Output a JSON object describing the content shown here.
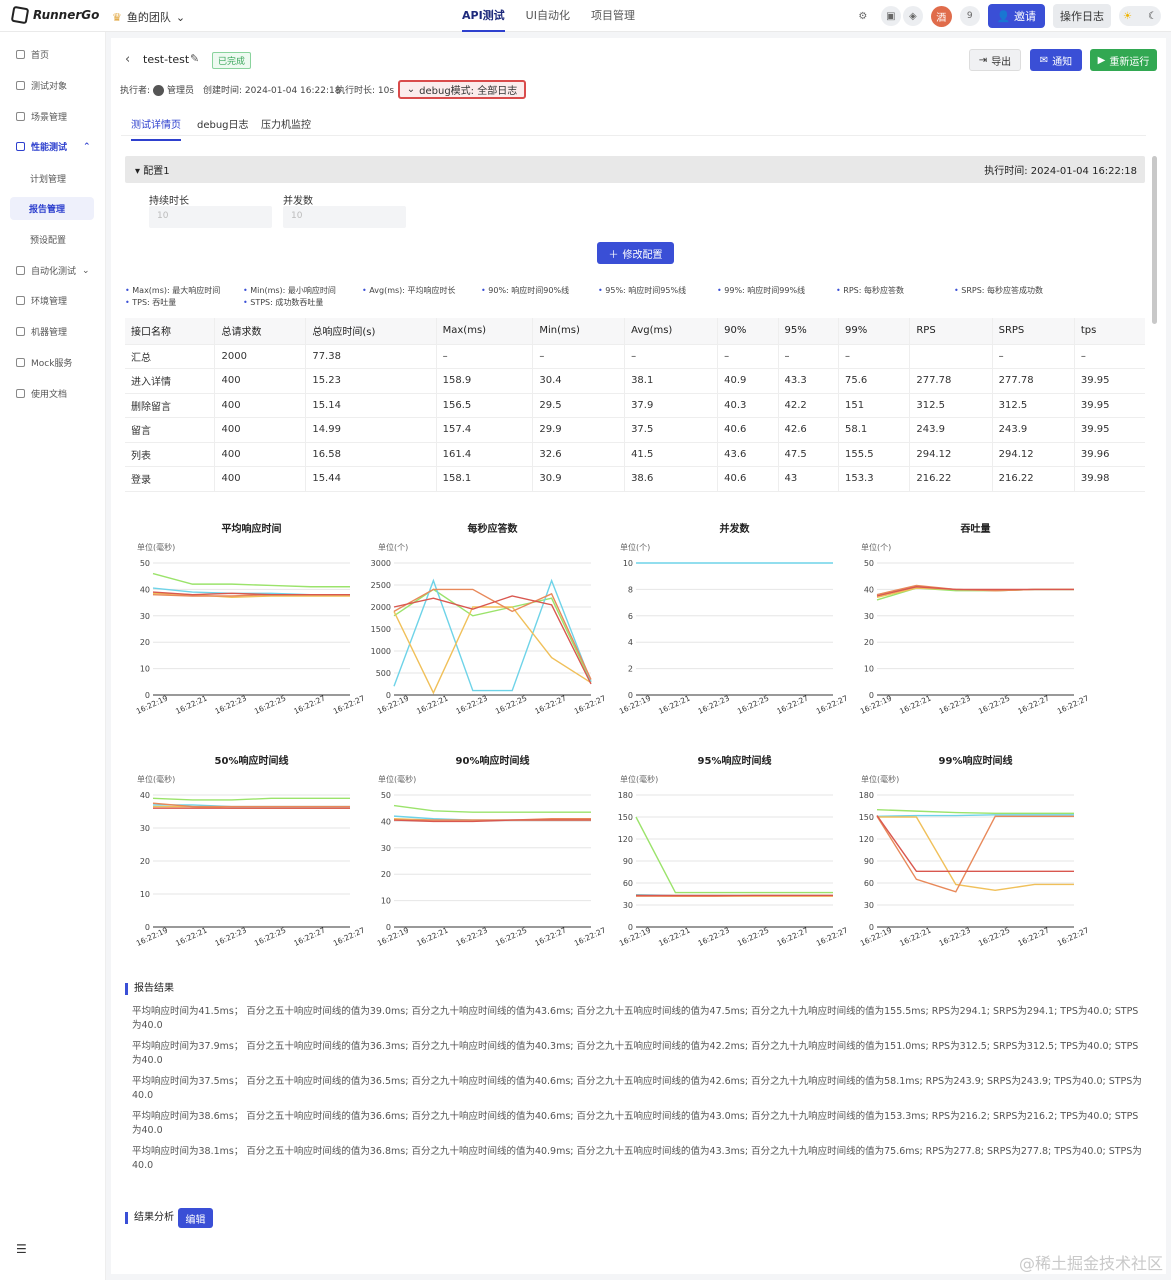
{
  "app": {
    "logo_text": "RunnerGo",
    "team": "鱼的团队"
  },
  "top_nav": {
    "tabs": [
      "API测试",
      "UI自动化",
      "项目管理"
    ],
    "active": 0
  },
  "top_right": {
    "member_count": "9",
    "invite": "邀请",
    "op_log": "操作日志"
  },
  "sidebar": {
    "items": [
      "首页",
      "测试对象",
      "场景管理",
      "性能测试",
      "计划管理",
      "报告管理",
      "预设配置",
      "自动化测试",
      "环境管理",
      "机器管理",
      "Mock服务",
      "使用文档"
    ]
  },
  "report": {
    "title": "test-test",
    "status": "已完成",
    "buttons": {
      "export": "导出",
      "notify": "通知",
      "rerun": "重新运行"
    },
    "meta": {
      "executor_label": "执行者:",
      "executor": "管理员",
      "created": "创建时间: 2024-01-04 16:22:18",
      "duration": "执行时长: 10s"
    },
    "debug_mode": "debug模式: 全部日志",
    "tabs": [
      "测试详情页",
      "debug日志",
      "压力机监控"
    ]
  },
  "config": {
    "name": "配置1",
    "exec_time": "执行时间: 2024-01-04 16:22:18",
    "duration_label": "持续时长",
    "duration_value": "10",
    "concurrency_label": "并发数",
    "concurrency_value": "10",
    "modify": "修改配置"
  },
  "legend_notes": [
    "Max(ms): 最大响应时间",
    "Min(ms): 最小响应时间",
    "Avg(ms): 平均响应时长",
    "90%: 响应时间90%线",
    "95%: 响应时间95%线",
    "99%: 响应时间99%线",
    "RPS: 每秒应答数",
    "SRPS: 每秒应答成功数",
    "TPS: 吞吐量",
    "STPS: 成功数吞吐量"
  ],
  "table": {
    "headers": [
      "接口名称",
      "总请求数",
      "总响应时间(s)",
      "Max(ms)",
      "Min(ms)",
      "Avg(ms)",
      "90%",
      "95%",
      "99%",
      "RPS",
      "SRPS",
      "tps"
    ],
    "rows": [
      [
        "汇总",
        "2000",
        "77.38",
        "–",
        "–",
        "–",
        "–",
        "–",
        "–",
        "",
        "–",
        "–"
      ],
      [
        "进入详情",
        "400",
        "15.23",
        "158.9",
        "30.4",
        "38.1",
        "40.9",
        "43.3",
        "75.6",
        "277.78",
        "277.78",
        "39.95"
      ],
      [
        "删除留言",
        "400",
        "15.14",
        "156.5",
        "29.5",
        "37.9",
        "40.3",
        "42.2",
        "151",
        "312.5",
        "312.5",
        "39.95"
      ],
      [
        "留言",
        "400",
        "14.99",
        "157.4",
        "29.9",
        "37.5",
        "40.6",
        "42.6",
        "58.1",
        "243.9",
        "243.9",
        "39.95"
      ],
      [
        "列表",
        "400",
        "16.58",
        "161.4",
        "32.6",
        "41.5",
        "43.6",
        "47.5",
        "155.5",
        "294.12",
        "294.12",
        "39.96"
      ],
      [
        "登录",
        "400",
        "15.44",
        "158.1",
        "30.9",
        "38.6",
        "40.6",
        "43",
        "153.3",
        "216.22",
        "216.22",
        "39.98"
      ]
    ]
  },
  "chart_data": [
    {
      "type": "line",
      "title": "平均响应时间",
      "ylabel": "单位(毫秒)",
      "ylim": [
        0,
        50
      ],
      "yticks": [
        0,
        10,
        20,
        30,
        40,
        50
      ],
      "x": [
        "16:22:19",
        "16:22:21",
        "16:22:23",
        "16:22:25",
        "16:22:27",
        "16:22:27"
      ],
      "series": [
        {
          "color": "#9be36b",
          "values": [
            46,
            42,
            42,
            41.5,
            41,
            41
          ]
        },
        {
          "color": "#6ed3e8",
          "values": [
            40.5,
            39,
            38.5,
            38.5,
            38,
            38
          ]
        },
        {
          "color": "#f0c05a",
          "values": [
            38.5,
            38,
            37,
            37.5,
            37.5,
            37.5
          ]
        },
        {
          "color": "#e8895a",
          "values": [
            38,
            37.5,
            37.5,
            38,
            38,
            38
          ]
        },
        {
          "color": "#d9574f",
          "values": [
            39,
            38,
            38.5,
            38,
            38,
            38
          ]
        }
      ]
    },
    {
      "type": "line",
      "title": "每秒应答数",
      "ylabel": "单位(个)",
      "ylim": [
        0,
        3000
      ],
      "yticks": [
        0,
        500,
        1000,
        1500,
        2000,
        2500,
        3000
      ],
      "x": [
        "16:22:19",
        "16:22:21",
        "16:22:23",
        "16:22:25",
        "16:22:27",
        "16:22:27"
      ],
      "series": [
        {
          "color": "#9be36b",
          "values": [
            1800,
            2400,
            1800,
            2000,
            2200,
            300
          ]
        },
        {
          "color": "#6ed3e8",
          "values": [
            200,
            2600,
            100,
            100,
            2600,
            300
          ]
        },
        {
          "color": "#f0c05a",
          "values": [
            1900,
            50,
            2000,
            2000,
            850,
            280
          ]
        },
        {
          "color": "#e8895a",
          "values": [
            1900,
            2400,
            2400,
            1900,
            2300,
            350
          ]
        },
        {
          "color": "#d9574f",
          "values": [
            2000,
            2200,
            1950,
            2250,
            2050,
            250
          ]
        }
      ]
    },
    {
      "type": "line",
      "title": "并发数",
      "ylabel": "单位(个)",
      "ylim": [
        0,
        10
      ],
      "yticks": [
        0,
        2,
        4,
        6,
        8,
        10
      ],
      "x": [
        "16:22:19",
        "16:22:21",
        "16:22:23",
        "16:22:25",
        "16:22:27",
        "16:22:27"
      ],
      "series": [
        {
          "color": "#6ed3e8",
          "values": [
            10,
            10,
            10,
            10,
            10,
            10
          ]
        }
      ]
    },
    {
      "type": "line",
      "title": "吞吐量",
      "ylabel": "单位(个)",
      "ylim": [
        0,
        50
      ],
      "yticks": [
        0,
        10,
        20,
        30,
        40,
        50
      ],
      "x": [
        "16:22:19",
        "16:22:21",
        "16:22:23",
        "16:22:25",
        "16:22:27",
        "16:22:27"
      ],
      "series": [
        {
          "color": "#9be36b",
          "values": [
            36,
            40.5,
            39.5,
            39.5,
            40,
            40
          ]
        },
        {
          "color": "#6ed3e8",
          "values": [
            38,
            41,
            40,
            39.5,
            40,
            40
          ]
        },
        {
          "color": "#f0c05a",
          "values": [
            37,
            40.5,
            40,
            39.5,
            40,
            40
          ]
        },
        {
          "color": "#e8895a",
          "values": [
            38,
            41.5,
            40,
            39.5,
            40,
            40
          ]
        },
        {
          "color": "#d9574f",
          "values": [
            37.5,
            41,
            40,
            40,
            40,
            40
          ]
        }
      ]
    },
    {
      "type": "line",
      "title": "50%响应时间线",
      "ylabel": "单位(毫秒)",
      "ylim": [
        0,
        40
      ],
      "yticks": [
        0,
        10,
        20,
        30,
        40
      ],
      "x": [
        "16:22:19",
        "16:22:21",
        "16:22:23",
        "16:22:25",
        "16:22:27",
        "16:22:27"
      ],
      "series": [
        {
          "color": "#9be36b",
          "values": [
            39,
            38.5,
            38.5,
            39,
            39,
            39
          ]
        },
        {
          "color": "#6ed3e8",
          "values": [
            37,
            37,
            36.5,
            36.5,
            36.5,
            36.5
          ]
        },
        {
          "color": "#f0c05a",
          "values": [
            36.5,
            36.5,
            36,
            36,
            36,
            36
          ]
        },
        {
          "color": "#e8895a",
          "values": [
            37.5,
            36.5,
            36.5,
            36.5,
            36.5,
            36.5
          ]
        },
        {
          "color": "#d9574f",
          "values": [
            36,
            36,
            36,
            36,
            36,
            36
          ]
        }
      ]
    },
    {
      "type": "line",
      "title": "90%响应时间线",
      "ylabel": "单位(毫秒)",
      "ylim": [
        0,
        50
      ],
      "yticks": [
        0,
        10,
        20,
        30,
        40,
        50
      ],
      "x": [
        "16:22:19",
        "16:22:21",
        "16:22:23",
        "16:22:25",
        "16:22:27",
        "16:22:27"
      ],
      "series": [
        {
          "color": "#9be36b",
          "values": [
            46,
            44,
            43.5,
            43.5,
            43.5,
            43.5
          ]
        },
        {
          "color": "#6ed3e8",
          "values": [
            42,
            41,
            40.5,
            40.5,
            40.5,
            40.5
          ]
        },
        {
          "color": "#f0c05a",
          "values": [
            41,
            40.5,
            40.5,
            40.5,
            40.5,
            40.5
          ]
        },
        {
          "color": "#e8895a",
          "values": [
            40.5,
            40.5,
            40.5,
            40.5,
            41,
            41
          ]
        },
        {
          "color": "#d9574f",
          "values": [
            40.5,
            40,
            40,
            40.5,
            40.5,
            40.5
          ]
        }
      ]
    },
    {
      "type": "line",
      "title": "95%响应时间线",
      "ylabel": "单位(毫秒)",
      "ylim": [
        0,
        180
      ],
      "yticks": [
        0,
        30,
        60,
        90,
        120,
        150,
        180
      ],
      "x": [
        "16:22:19",
        "16:22:21",
        "16:22:23",
        "16:22:25",
        "16:22:27",
        "16:22:27"
      ],
      "series": [
        {
          "color": "#9be36b",
          "values": [
            150,
            47,
            47,
            47,
            47,
            47
          ]
        },
        {
          "color": "#6ed3e8",
          "values": [
            44,
            43,
            43,
            43,
            43,
            43
          ]
        },
        {
          "color": "#f0c05a",
          "values": [
            43,
            42,
            42,
            42,
            42,
            42
          ]
        },
        {
          "color": "#e8895a",
          "values": [
            42,
            42,
            42,
            43,
            43,
            43
          ]
        },
        {
          "color": "#d9574f",
          "values": [
            43,
            43,
            43,
            43,
            43,
            43
          ]
        }
      ]
    },
    {
      "type": "line",
      "title": "99%响应时间线",
      "ylabel": "单位(毫秒)",
      "ylim": [
        0,
        180
      ],
      "yticks": [
        0,
        30,
        60,
        90,
        120,
        150,
        180
      ],
      "x": [
        "16:22:19",
        "16:22:21",
        "16:22:23",
        "16:22:25",
        "16:22:27",
        "16:22:27"
      ],
      "series": [
        {
          "color": "#9be36b",
          "values": [
            160,
            158,
            156,
            155,
            155,
            155
          ]
        },
        {
          "color": "#6ed3e8",
          "values": [
            151,
            152,
            152,
            153,
            153,
            153
          ]
        },
        {
          "color": "#f0c05a",
          "values": [
            150,
            150,
            58,
            50,
            58,
            58
          ]
        },
        {
          "color": "#e8895a",
          "values": [
            151,
            65,
            48,
            151,
            151,
            151
          ]
        },
        {
          "color": "#d9574f",
          "values": [
            152,
            76,
            76,
            76,
            76,
            76
          ]
        }
      ]
    }
  ],
  "report_result": {
    "title": "报告结果",
    "lines": [
      "平均响应时间为41.5ms；  百分之五十响应时间线的值为39.0ms; 百分之九十响应时间线的值为43.6ms; 百分之九十五响应时间线的值为47.5ms; 百分之九十九响应时间线的值为155.5ms; RPS为294.1; SRPS为294.1; TPS为40.0; STPS为40.0",
      "平均响应时间为37.9ms；  百分之五十响应时间线的值为36.3ms; 百分之九十响应时间线的值为40.3ms; 百分之九十五响应时间线的值为42.2ms; 百分之九十九响应时间线的值为151.0ms; RPS为312.5; SRPS为312.5; TPS为40.0; STPS为40.0",
      "平均响应时间为37.5ms；  百分之五十响应时间线的值为36.5ms; 百分之九十响应时间线的值为40.6ms; 百分之九十五响应时间线的值为42.6ms; 百分之九十九响应时间线的值为58.1ms; RPS为243.9; SRPS为243.9; TPS为40.0; STPS为40.0",
      "平均响应时间为38.6ms；  百分之五十响应时间线的值为36.6ms; 百分之九十响应时间线的值为40.6ms; 百分之九十五响应时间线的值为43.0ms; 百分之九十九响应时间线的值为153.3ms; RPS为216.2; SRPS为216.2; TPS为40.0; STPS为40.0",
      "平均响应时间为38.1ms；  百分之五十响应时间线的值为36.8ms; 百分之九十响应时间线的值为40.9ms; 百分之九十五响应时间线的值为43.3ms; 百分之九十九响应时间线的值为75.6ms; RPS为277.8; SRPS为277.8; TPS为40.0; STPS为40.0"
    ]
  },
  "analysis": {
    "title": "结果分析",
    "edit": "编辑"
  },
  "watermark": "@稀土掘金技术社区"
}
